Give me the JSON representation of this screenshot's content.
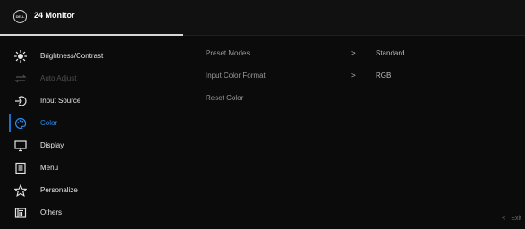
{
  "header": {
    "logo_text": "DELL",
    "title": "24 Monitor"
  },
  "menu": {
    "items": [
      {
        "label": "Brightness/Contrast",
        "icon": "brightness-icon",
        "state": "normal"
      },
      {
        "label": "Auto Adjust",
        "icon": "auto-adjust-icon",
        "state": "disabled"
      },
      {
        "label": "Input Source",
        "icon": "input-source-icon",
        "state": "normal"
      },
      {
        "label": "Color",
        "icon": "color-palette-icon",
        "state": "active"
      },
      {
        "label": "Display",
        "icon": "display-icon",
        "state": "normal"
      },
      {
        "label": "Menu",
        "icon": "menu-icon",
        "state": "normal"
      },
      {
        "label": "Personalize",
        "icon": "star-icon",
        "state": "normal"
      },
      {
        "label": "Others",
        "icon": "others-icon",
        "state": "normal"
      }
    ]
  },
  "color_panel": {
    "rows": [
      {
        "label": "Preset Modes",
        "chevron": ">",
        "value": "Standard"
      },
      {
        "label": "Input Color Format",
        "chevron": ">",
        "value": "RGB"
      },
      {
        "label": "Reset Color",
        "chevron": "",
        "value": ""
      }
    ]
  },
  "footer": {
    "exit_arrow": "<",
    "exit_label": "Exit"
  },
  "colors": {
    "accent": "#2b8cf0",
    "background": "#0b0b0b",
    "disabled_text": "#4f4f4f"
  }
}
